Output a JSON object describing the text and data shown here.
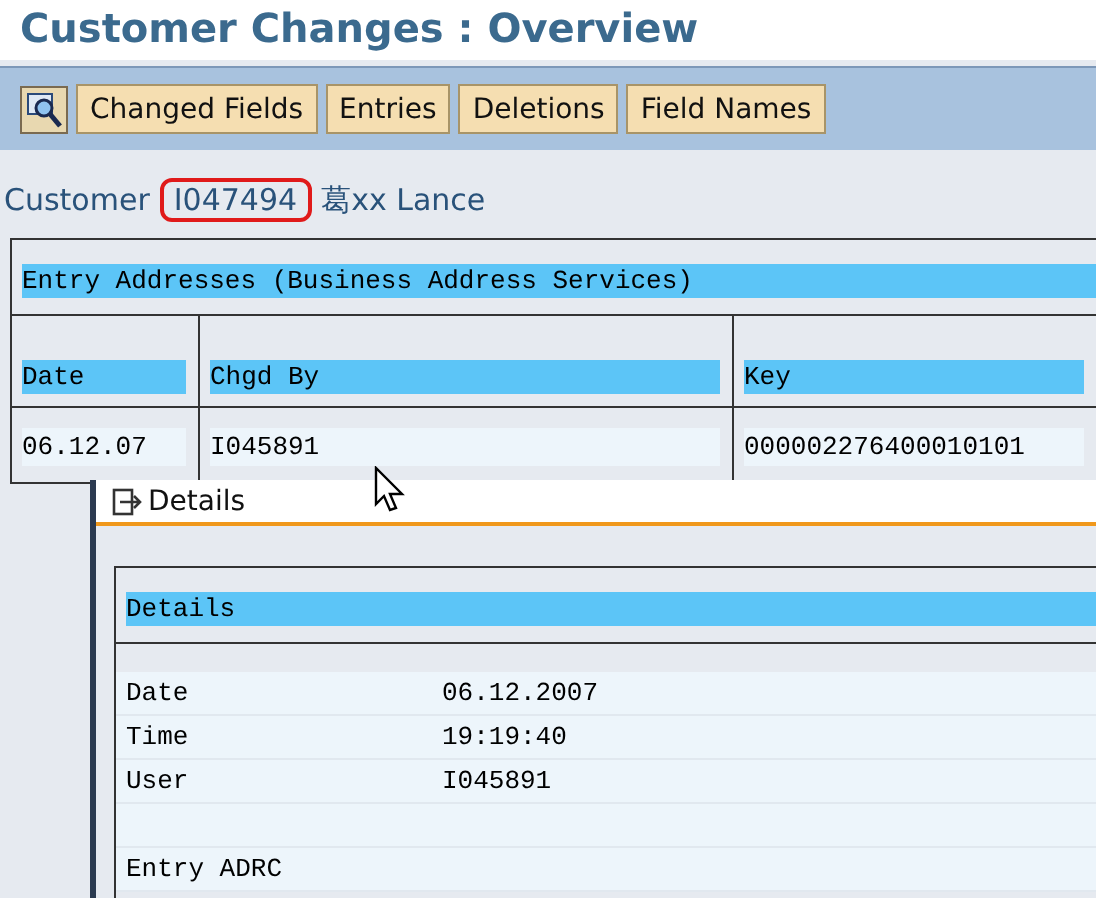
{
  "title": "Customer Changes : Overview",
  "toolbar": {
    "buttons": [
      "Changed Fields",
      "Entries",
      "Deletions",
      "Field Names"
    ]
  },
  "customer": {
    "label": "Customer",
    "id": "I047494",
    "id_highlighted": true,
    "name": "葛xx Lance"
  },
  "table": {
    "title": "Entry Addresses (Business Address Services)",
    "columns": [
      "Date",
      "Chgd By",
      "Key"
    ],
    "rows": [
      [
        "06.12.07",
        "I045891",
        "000002276400010101"
      ]
    ]
  },
  "details_dialog": {
    "title": "Details",
    "section": "Details",
    "fields": [
      {
        "label": "Date",
        "value": "06.12.2007"
      },
      {
        "label": "Time",
        "value": "19:19:40"
      },
      {
        "label": "User",
        "value": "I045891"
      }
    ],
    "entry": "Entry ADRC"
  }
}
